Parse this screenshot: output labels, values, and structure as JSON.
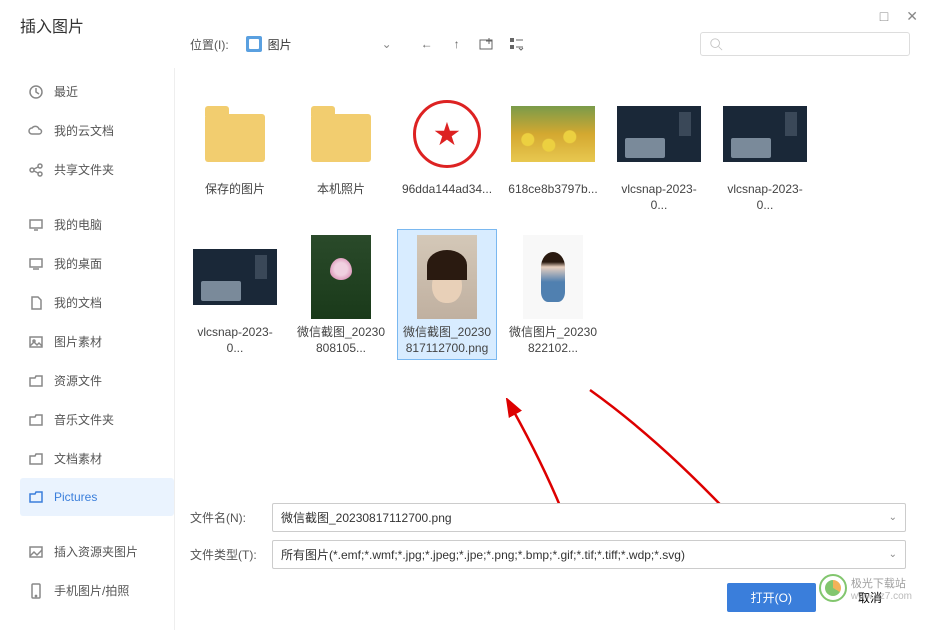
{
  "title": "插入图片",
  "topbar": {
    "location_label": "位置(I):",
    "location_value": "图片"
  },
  "sidebar": {
    "recent": "最近",
    "cloud": "我的云文档",
    "shared": "共享文件夹",
    "computer": "我的电脑",
    "desktop": "我的桌面",
    "documents": "我的文档",
    "pic_material": "图片素材",
    "resources": "资源文件",
    "music": "音乐文件夹",
    "doc_material": "文档素材",
    "pictures": "Pictures",
    "insert_res": "插入资源夹图片",
    "phone": "手机图片/拍照"
  },
  "files": [
    {
      "name": "保存的图片",
      "type": "folder"
    },
    {
      "name": "本机照片",
      "type": "folder"
    },
    {
      "name": "96dda144ad34...",
      "type": "stamp"
    },
    {
      "name": "618ce8b3797b...",
      "type": "tulips"
    },
    {
      "name": "vlcsnap-2023-0...",
      "type": "dark"
    },
    {
      "name": "vlcsnap-2023-0...",
      "type": "dark"
    },
    {
      "name": "vlcsnap-2023-0...",
      "type": "dark"
    },
    {
      "name": "微信截图_2023080810​5...",
      "type": "lotus"
    },
    {
      "name": "微信截图_2023081711270​0.png",
      "type": "face",
      "selected": true
    },
    {
      "name": "微信图片_2023082210​2...",
      "type": "girl"
    }
  ],
  "bottom": {
    "filename_label": "文件名(N):",
    "filename_value": "微信截图_20230817112700.png",
    "filetype_label": "文件类型(T):",
    "filetype_value": "所有图片(*.emf;*.wmf;*.jpg;*.jpeg;*.jpe;*.png;*.bmp;*.gif;*.tif;*.tiff;*.wdp;*.svg)",
    "open": "打开(O)",
    "cancel": "取消"
  },
  "watermark": {
    "text": "极光下载站",
    "url": "www.xz7.com"
  }
}
